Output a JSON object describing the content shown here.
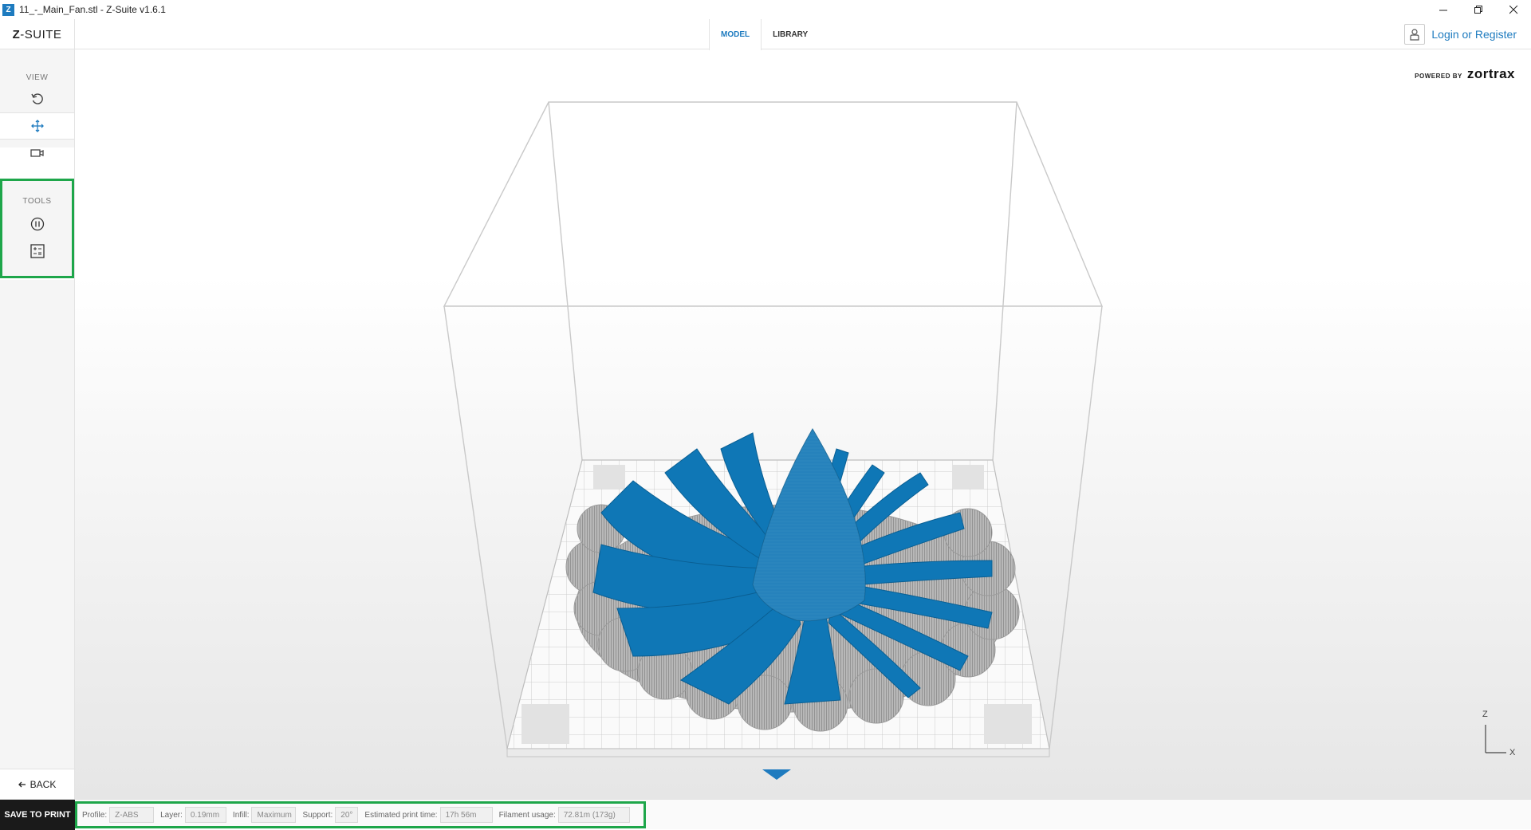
{
  "window": {
    "title": "11_-_Main_Fan.stl - Z-Suite v1.6.1",
    "app_icon_letter": "Z"
  },
  "header": {
    "logo_bold": "Z",
    "logo_rest": "-SUITE",
    "tabs": [
      {
        "label": "MODEL",
        "active": true
      },
      {
        "label": "LIBRARY",
        "active": false
      }
    ],
    "login_label": "Login or Register"
  },
  "sidebar": {
    "view_label": "VIEW",
    "tools_label": "TOOLS",
    "back_label": "BACK"
  },
  "viewport": {
    "powered_by": "POWERED BY",
    "brand": "zortrax",
    "axis_z": "Z",
    "axis_x": "X",
    "model_color": "#0f77b6"
  },
  "bottombar": {
    "save_label": "SAVE TO PRINT",
    "profile_label": "Profile:",
    "profile_value": "Z-ABS",
    "layer_label": "Layer:",
    "layer_value": "0.19mm",
    "infill_label": "Infill:",
    "infill_value": "Maximum",
    "support_label": "Support:",
    "support_value": "20°",
    "time_label": "Estimated print time:",
    "time_value": "17h 56m",
    "filament_label": "Filament usage:",
    "filament_value": "72.81m (173g)"
  }
}
